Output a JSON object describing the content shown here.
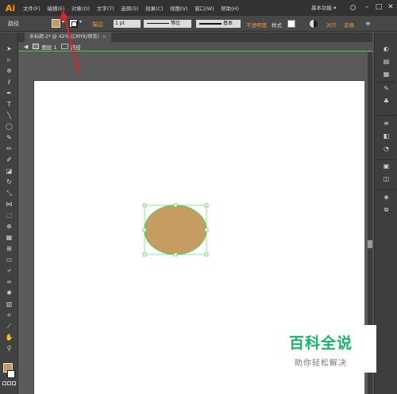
{
  "app": {
    "logo": "Ai",
    "brand_color": "#ff9a00"
  },
  "menubar": {
    "items": [
      "文件(F)",
      "编辑(E)",
      "对象(O)",
      "文字(T)",
      "选择(S)",
      "效果(C)",
      "视图(V)",
      "窗口(W)",
      "帮助(H)"
    ],
    "workspace": "基本功能 ▾"
  },
  "controlbar": {
    "object_label": "路径",
    "fill_color": "#c79c63",
    "stroke_label": "描边",
    "stroke_weight": "1 pt",
    "profile_label": "等比",
    "brush_label": "基本",
    "opacity_label": "不透明度",
    "style_label": "样式",
    "isolate_label": "对齐",
    "transform_label": "变换"
  },
  "document": {
    "tab_title": "未标题-2* @ 42% (CMYK/预览)",
    "breadcrumb": {
      "layer": "图层 1",
      "path": "路径"
    }
  },
  "artwork": {
    "shape": "ellipse",
    "fill_color": "#c79c63",
    "selection_color": "#3fd15a"
  },
  "watermark": {
    "title": "百科全说",
    "subtitle": "助你轻松解决"
  }
}
